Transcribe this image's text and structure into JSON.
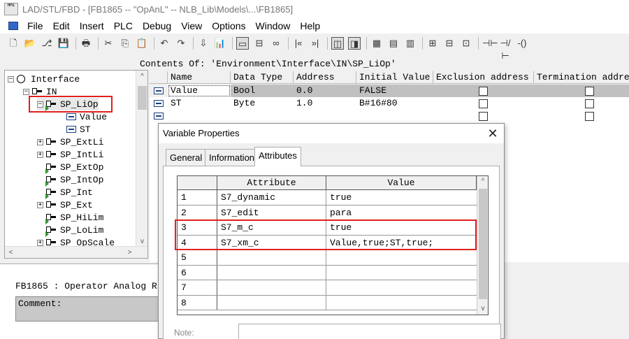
{
  "window": {
    "title": "LAD/STL/FBD  - [FB1865 -- \"OpAnL\" -- NLB_Lib\\Models\\...\\FB1865]",
    "logo_text": "HMI"
  },
  "menu": [
    "File",
    "Edit",
    "Insert",
    "PLC",
    "Debug",
    "View",
    "Options",
    "Window",
    "Help"
  ],
  "toolbar": {
    "icons": [
      "new-icon",
      "open-icon",
      "network-icon",
      "save-icon",
      "print-icon",
      "cut-icon",
      "copy-icon",
      "paste-icon",
      "undo-icon",
      "redo-icon",
      "download-icon",
      "monitor-icon",
      "selected-tool-icon",
      "compare-icon",
      "glasses-icon",
      "prev-icon",
      "next-icon",
      "view1-icon",
      "view2-icon",
      "view3-icon",
      "view4-icon",
      "view5-icon",
      "ladder1-icon",
      "ladder2-icon",
      "ladder3-icon",
      "contact-no-icon",
      "contact-nc-icon",
      "coil-icon"
    ],
    "glyphs": [
      "🗋",
      "📂",
      "⎇",
      "💾",
      "🖶",
      "✂",
      "⎘",
      "📋",
      "↶",
      "↷",
      "⇩",
      "📊",
      "▭",
      "⊟",
      "∞",
      "|«",
      "»|",
      "◫",
      "◨",
      "▦",
      "▤",
      "▥",
      "⊞",
      "⊟",
      "⊡",
      "⊣⊢",
      "⊣/⊢",
      "-()"
    ]
  },
  "tree": {
    "items": [
      {
        "label": "Interface",
        "expander": "−",
        "kind": "root"
      },
      {
        "label": "IN",
        "expander": "−",
        "kind": "folder"
      },
      {
        "label": "SP_LiOp",
        "expander": "−",
        "kind": "struct"
      },
      {
        "label": "Value",
        "expander": "",
        "kind": "var"
      },
      {
        "label": "ST",
        "expander": "",
        "kind": "var"
      },
      {
        "label": "SP_ExtLi",
        "expander": "+",
        "kind": "struct"
      },
      {
        "label": "SP_IntLi",
        "expander": "+",
        "kind": "struct"
      },
      {
        "label": "SP_ExtOp",
        "expander": "",
        "kind": "struct"
      },
      {
        "label": "SP_IntOp",
        "expander": "",
        "kind": "struct"
      },
      {
        "label": "SP_Int",
        "expander": "",
        "kind": "struct"
      },
      {
        "label": "SP_Ext",
        "expander": "+",
        "kind": "struct"
      },
      {
        "label": "SP_HiLim",
        "expander": "",
        "kind": "struct"
      },
      {
        "label": "SP_LoLim",
        "expander": "",
        "kind": "struct"
      },
      {
        "label": "SP_OpScale",
        "expander": "+",
        "kind": "struct"
      }
    ]
  },
  "contents": {
    "title": "Contents Of: 'Environment\\Interface\\IN\\SP_LiOp'",
    "columns": [
      "Name",
      "Data Type",
      "Address",
      "Initial Value",
      "Exclusion address",
      "Termination address"
    ],
    "rows": [
      {
        "name": "Value",
        "data_type": "Bool",
        "address": "0.0",
        "initial_value": "FALSE"
      },
      {
        "name": "ST",
        "data_type": "Byte",
        "address": "1.0",
        "initial_value": "B#16#80"
      },
      {
        "name": "",
        "data_type": "",
        "address": "",
        "initial_value": ""
      }
    ]
  },
  "lower": {
    "description": "FB1865 : Operator Analog R",
    "comment_label": "Comment:"
  },
  "dialog": {
    "title": "Variable Properties",
    "close": "✕",
    "tabs": [
      "General",
      "Information",
      "Attributes"
    ],
    "active_tab": "Attributes",
    "table": {
      "headers": [
        "Attribute",
        "Value"
      ],
      "rows": [
        {
          "num": "1",
          "attribute": "S7_dynamic",
          "value": "true"
        },
        {
          "num": "2",
          "attribute": "S7_edit",
          "value": "para"
        },
        {
          "num": "3",
          "attribute": "S7_m_c",
          "value": "true"
        },
        {
          "num": "4",
          "attribute": "S7_xm_c",
          "value": "Value,true;ST,true;"
        },
        {
          "num": "5",
          "attribute": "",
          "value": ""
        },
        {
          "num": "6",
          "attribute": "",
          "value": ""
        },
        {
          "num": "7",
          "attribute": "",
          "value": ""
        },
        {
          "num": "8",
          "attribute": "",
          "value": ""
        }
      ]
    },
    "note_label": "Note:"
  },
  "scroll": {
    "up": "▲",
    "down": "▼",
    "left": "◀",
    "right": "▶",
    "up2": "^",
    "down2": "v",
    "left2": "<",
    "right2": ">"
  },
  "colors": {
    "highlight": "#e02020",
    "selected_row": "#c0c0c0"
  }
}
